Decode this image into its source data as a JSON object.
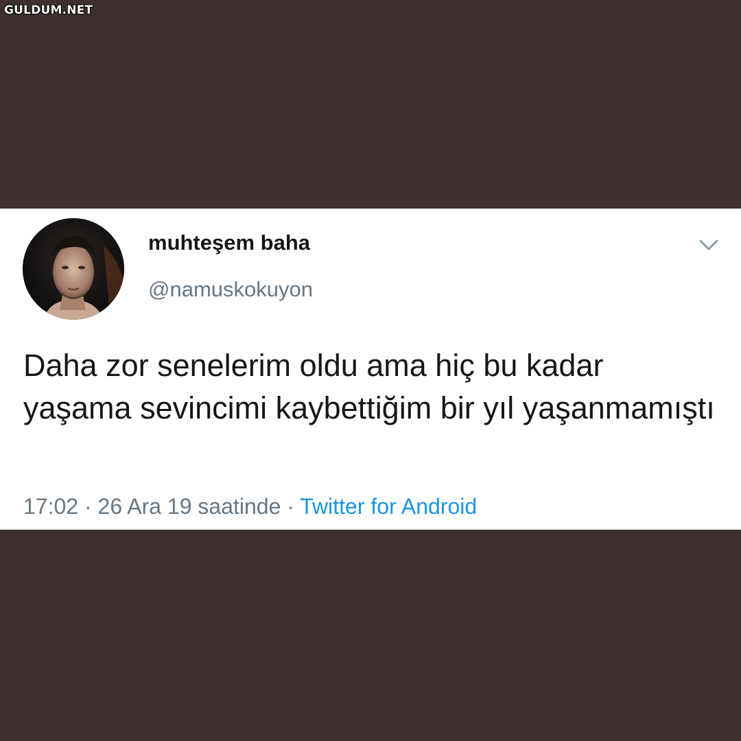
{
  "watermark": "GULDUM.NET",
  "tweet": {
    "author": {
      "display_name": "muhteşem baha",
      "handle": "@namuskokuyon",
      "avatar_icon": "avatar-photo"
    },
    "text": "Daha zor senelerim oldu ama hiç bu kadar yaşama sevincimi kaybettiğim bir yıl yaşanmamıştı",
    "time": "17:02",
    "separator": "·",
    "date": "26 Ara 19 saatinde",
    "source": "Twitter for Android",
    "menu_icon": "chevron-down-icon"
  },
  "colors": {
    "background": "#3e302e",
    "card": "#ffffff",
    "text": "#14171a",
    "muted": "#657786",
    "link": "#1b95e0"
  }
}
